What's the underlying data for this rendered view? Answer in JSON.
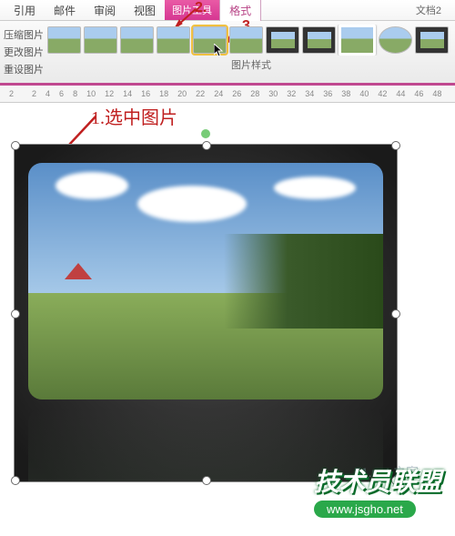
{
  "doc_name": "文档2",
  "tabs": {
    "ref": "引用",
    "mail": "邮件",
    "review": "审阅",
    "view": "视图"
  },
  "tool": {
    "group": "图片工具",
    "format": "格式"
  },
  "side": {
    "compress": "压缩图片",
    "change": "更改图片",
    "reset": "重设图片"
  },
  "styles_label": "图片样式",
  "ruler_marks": [
    "2",
    "",
    "2",
    "4",
    "6",
    "8",
    "10",
    "12",
    "14",
    "16",
    "18",
    "20",
    "22",
    "24",
    "26",
    "28",
    "30",
    "32",
    "34",
    "36",
    "38",
    "40",
    "42",
    "44",
    "46",
    "48"
  ],
  "annotations": {
    "a1": "1.选中图片",
    "a2": "2.",
    "a3": "3."
  },
  "watermark": {
    "text": "技术员联盟",
    "url": "www.jsgho.net",
    "faint": "51.net\n之家"
  }
}
